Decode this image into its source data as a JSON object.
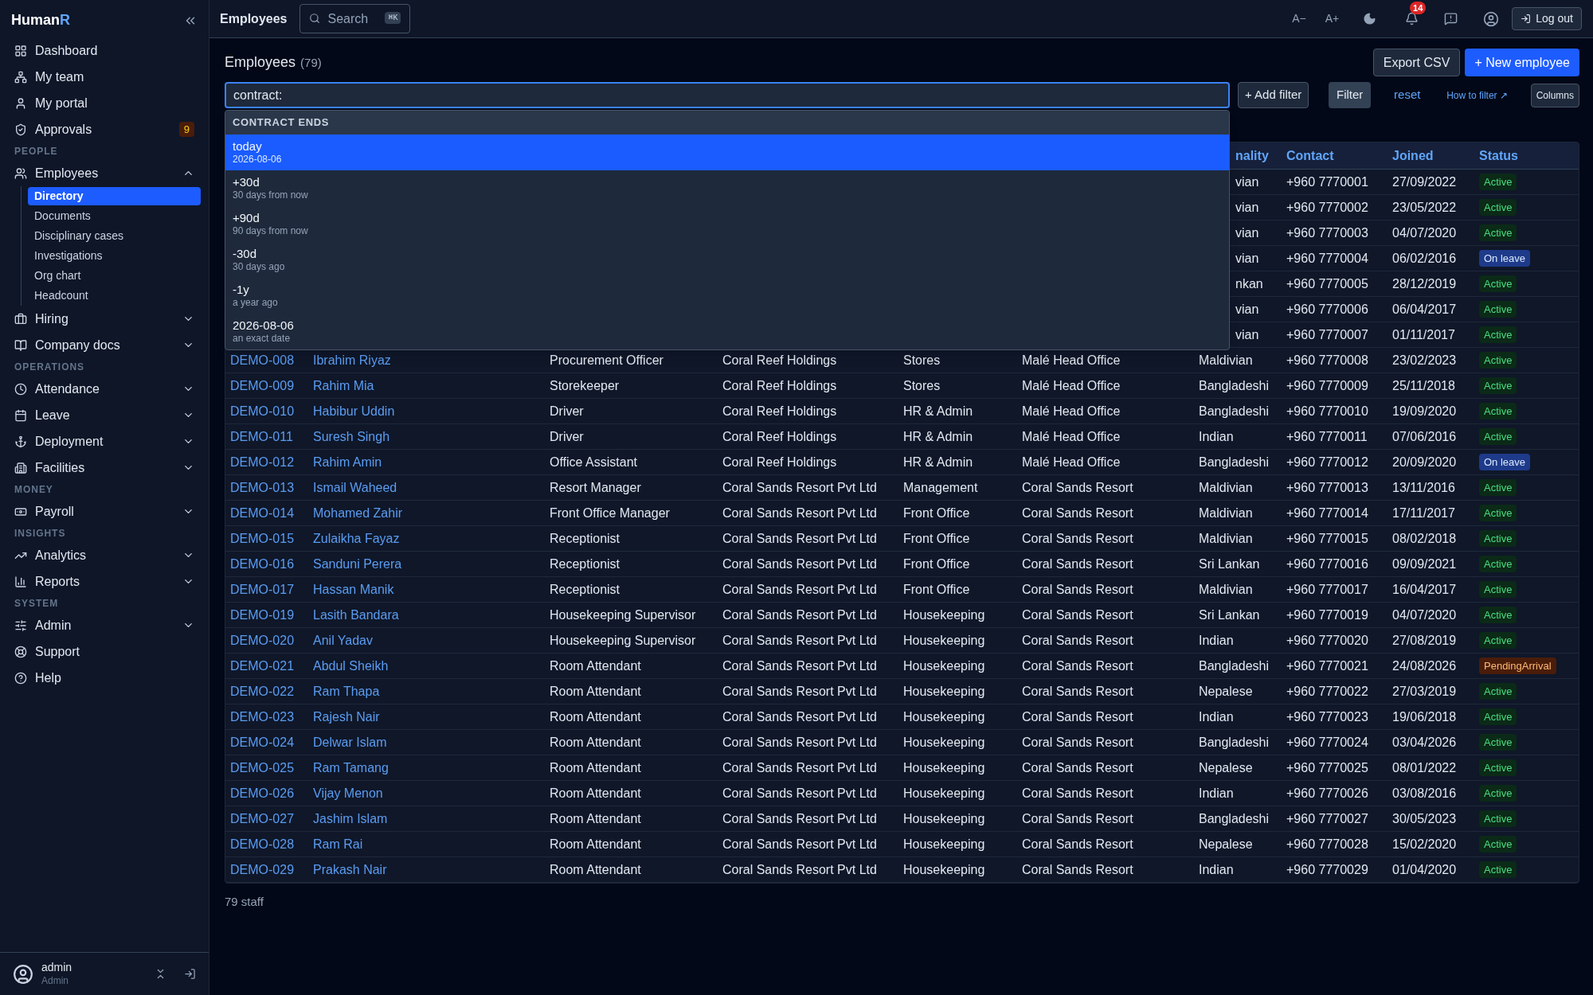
{
  "sidebar": {
    "brand_main": "Human",
    "brand_accent": "R",
    "nav": [
      {
        "kind": "item",
        "label": "Dashboard"
      },
      {
        "kind": "item",
        "label": "My team"
      },
      {
        "kind": "item",
        "label": "My portal"
      },
      {
        "kind": "item",
        "label": "Approvals",
        "badge": "9"
      },
      {
        "kind": "section",
        "label": "PEOPLE"
      },
      {
        "kind": "item",
        "label": "Employees",
        "expanded": true,
        "children": [
          {
            "label": "Directory",
            "selected": true
          },
          {
            "label": "Documents",
            "selected": false
          },
          {
            "label": "Disciplinary cases",
            "selected": false
          },
          {
            "label": "Investigations",
            "selected": false
          },
          {
            "label": "Org chart",
            "selected": false
          },
          {
            "label": "Headcount",
            "selected": false
          }
        ]
      },
      {
        "kind": "item",
        "label": "Hiring",
        "expanded": false
      },
      {
        "kind": "item",
        "label": "Company docs",
        "expanded": false
      },
      {
        "kind": "section",
        "label": "OPERATIONS"
      },
      {
        "kind": "item",
        "label": "Attendance",
        "expanded": false
      },
      {
        "kind": "item",
        "label": "Leave",
        "expanded": false
      },
      {
        "kind": "item",
        "label": "Deployment",
        "expanded": false
      },
      {
        "kind": "item",
        "label": "Facilities",
        "expanded": false
      },
      {
        "kind": "section",
        "label": "MONEY"
      },
      {
        "kind": "item",
        "label": "Payroll",
        "expanded": false
      },
      {
        "kind": "section",
        "label": "INSIGHTS"
      },
      {
        "kind": "item",
        "label": "Analytics",
        "expanded": false
      },
      {
        "kind": "item",
        "label": "Reports",
        "expanded": false
      },
      {
        "kind": "section",
        "label": "SYSTEM"
      },
      {
        "kind": "item",
        "label": "Admin",
        "expanded": false
      },
      {
        "kind": "item",
        "label": "Support"
      },
      {
        "kind": "item",
        "label": "Help"
      }
    ],
    "user": {
      "name": "admin",
      "role": "Admin"
    }
  },
  "topbar": {
    "title": "Employees",
    "search": {
      "placeholder": "Search",
      "shortcut": "⌘K"
    },
    "font_smaller": "A−",
    "font_larger": "A+",
    "notification_count": "14",
    "logout": "Log out"
  },
  "page": {
    "title": "Employees",
    "count": "(79)",
    "export": "Export CSV",
    "new": "+ New employee"
  },
  "filter": {
    "value": "contract:",
    "add_filter": "+ Add filter",
    "apply": "Filter",
    "reset": "reset",
    "help": "How to filter ↗",
    "columns": "Columns",
    "suggestions": {
      "heading": "CONTRACT ENDS",
      "options": [
        {
          "label": "today",
          "hint": "2026-08-06",
          "selected": true
        },
        {
          "label": "+30d",
          "hint": "30 days from now",
          "selected": false
        },
        {
          "label": "+90d",
          "hint": "90 days from now",
          "selected": false
        },
        {
          "label": "-30d",
          "hint": "30 days ago",
          "selected": false
        },
        {
          "label": "-1y",
          "hint": "a year ago",
          "selected": false
        },
        {
          "label": "2026-08-06",
          "hint": "an exact date",
          "selected": false
        }
      ]
    }
  },
  "table": {
    "columns": [
      "nality",
      "Contact",
      "Joined",
      "Status"
    ],
    "rows": [
      {
        "nationality": "vian",
        "contact": "+960 7770001",
        "joined": "27/09/2022",
        "status": {
          "label": "Active",
          "kind": "active"
        }
      },
      {
        "nationality": "vian",
        "contact": "+960 7770002",
        "joined": "23/05/2022",
        "status": {
          "label": "Active",
          "kind": "active"
        }
      },
      {
        "nationality": "vian",
        "contact": "+960 7770003",
        "joined": "04/07/2020",
        "status": {
          "label": "Active",
          "kind": "active"
        }
      },
      {
        "nationality": "vian",
        "contact": "+960 7770004",
        "joined": "06/02/2016",
        "status": {
          "label": "On leave",
          "kind": "leave"
        }
      },
      {
        "nationality": "nkan",
        "contact": "+960 7770005",
        "joined": "28/12/2019",
        "status": {
          "label": "Active",
          "kind": "active"
        }
      },
      {
        "nationality": "vian",
        "contact": "+960 7770006",
        "joined": "06/04/2017",
        "status": {
          "label": "Active",
          "kind": "active"
        }
      },
      {
        "nationality": "vian",
        "contact": "+960 7770007",
        "joined": "01/11/2017",
        "status": {
          "label": "Active",
          "kind": "active"
        }
      },
      {
        "id": "DEMO-008",
        "name": "Ibrahim Riyaz",
        "position": "Procurement Officer",
        "company": "Coral Reef Holdings",
        "department": "Stores",
        "location": "Malé Head Office",
        "nationality": "Maldivian",
        "contact": "+960 7770008",
        "joined": "23/02/2023",
        "status": {
          "label": "Active",
          "kind": "active"
        }
      },
      {
        "id": "DEMO-009",
        "name": "Rahim Mia",
        "position": "Storekeeper",
        "company": "Coral Reef Holdings",
        "department": "Stores",
        "location": "Malé Head Office",
        "nationality": "Bangladeshi",
        "contact": "+960 7770009",
        "joined": "25/11/2018",
        "status": {
          "label": "Active",
          "kind": "active"
        }
      },
      {
        "id": "DEMO-010",
        "name": "Habibur Uddin",
        "position": "Driver",
        "company": "Coral Reef Holdings",
        "department": "HR & Admin",
        "location": "Malé Head Office",
        "nationality": "Bangladeshi",
        "contact": "+960 7770010",
        "joined": "19/09/2020",
        "status": {
          "label": "Active",
          "kind": "active"
        }
      },
      {
        "id": "DEMO-011",
        "name": "Suresh Singh",
        "position": "Driver",
        "company": "Coral Reef Holdings",
        "department": "HR & Admin",
        "location": "Malé Head Office",
        "nationality": "Indian",
        "contact": "+960 7770011",
        "joined": "07/06/2016",
        "status": {
          "label": "Active",
          "kind": "active"
        }
      },
      {
        "id": "DEMO-012",
        "name": "Rahim Amin",
        "position": "Office Assistant",
        "company": "Coral Reef Holdings",
        "department": "HR & Admin",
        "location": "Malé Head Office",
        "nationality": "Bangladeshi",
        "contact": "+960 7770012",
        "joined": "20/09/2020",
        "status": {
          "label": "On leave",
          "kind": "leave"
        }
      },
      {
        "id": "DEMO-013",
        "name": "Ismail Waheed",
        "position": "Resort Manager",
        "company": "Coral Sands Resort Pvt Ltd",
        "department": "Management",
        "location": "Coral Sands Resort",
        "nationality": "Maldivian",
        "contact": "+960 7770013",
        "joined": "13/11/2016",
        "status": {
          "label": "Active",
          "kind": "active"
        }
      },
      {
        "id": "DEMO-014",
        "name": "Mohamed Zahir",
        "position": "Front Office Manager",
        "company": "Coral Sands Resort Pvt Ltd",
        "department": "Front Office",
        "location": "Coral Sands Resort",
        "nationality": "Maldivian",
        "contact": "+960 7770014",
        "joined": "17/11/2017",
        "status": {
          "label": "Active",
          "kind": "active"
        }
      },
      {
        "id": "DEMO-015",
        "name": "Zulaikha Fayaz",
        "position": "Receptionist",
        "company": "Coral Sands Resort Pvt Ltd",
        "department": "Front Office",
        "location": "Coral Sands Resort",
        "nationality": "Maldivian",
        "contact": "+960 7770015",
        "joined": "08/02/2018",
        "status": {
          "label": "Active",
          "kind": "active"
        }
      },
      {
        "id": "DEMO-016",
        "name": "Sanduni Perera",
        "position": "Receptionist",
        "company": "Coral Sands Resort Pvt Ltd",
        "department": "Front Office",
        "location": "Coral Sands Resort",
        "nationality": "Sri Lankan",
        "contact": "+960 7770016",
        "joined": "09/09/2021",
        "status": {
          "label": "Active",
          "kind": "active"
        }
      },
      {
        "id": "DEMO-017",
        "name": "Hassan Manik",
        "position": "Receptionist",
        "company": "Coral Sands Resort Pvt Ltd",
        "department": "Front Office",
        "location": "Coral Sands Resort",
        "nationality": "Maldivian",
        "contact": "+960 7770017",
        "joined": "16/04/2017",
        "status": {
          "label": "Active",
          "kind": "active"
        }
      },
      {
        "id": "DEMO-019",
        "name": "Lasith Bandara",
        "position": "Housekeeping Supervisor",
        "company": "Coral Sands Resort Pvt Ltd",
        "department": "Housekeeping",
        "location": "Coral Sands Resort",
        "nationality": "Sri Lankan",
        "contact": "+960 7770019",
        "joined": "04/07/2020",
        "status": {
          "label": "Active",
          "kind": "active"
        }
      },
      {
        "id": "DEMO-020",
        "name": "Anil Yadav",
        "position": "Housekeeping Supervisor",
        "company": "Coral Sands Resort Pvt Ltd",
        "department": "Housekeeping",
        "location": "Coral Sands Resort",
        "nationality": "Indian",
        "contact": "+960 7770020",
        "joined": "27/08/2019",
        "status": {
          "label": "Active",
          "kind": "active"
        }
      },
      {
        "id": "DEMO-021",
        "name": "Abdul Sheikh",
        "position": "Room Attendant",
        "company": "Coral Sands Resort Pvt Ltd",
        "department": "Housekeeping",
        "location": "Coral Sands Resort",
        "nationality": "Bangladeshi",
        "contact": "+960 7770021",
        "joined": "24/08/2026",
        "status": {
          "label": "PendingArrival",
          "kind": "pending"
        }
      },
      {
        "id": "DEMO-022",
        "name": "Ram Thapa",
        "position": "Room Attendant",
        "company": "Coral Sands Resort Pvt Ltd",
        "department": "Housekeeping",
        "location": "Coral Sands Resort",
        "nationality": "Nepalese",
        "contact": "+960 7770022",
        "joined": "27/03/2019",
        "status": {
          "label": "Active",
          "kind": "active"
        }
      },
      {
        "id": "DEMO-023",
        "name": "Rajesh Nair",
        "position": "Room Attendant",
        "company": "Coral Sands Resort Pvt Ltd",
        "department": "Housekeeping",
        "location": "Coral Sands Resort",
        "nationality": "Indian",
        "contact": "+960 7770023",
        "joined": "19/06/2018",
        "status": {
          "label": "Active",
          "kind": "active"
        }
      },
      {
        "id": "DEMO-024",
        "name": "Delwar Islam",
        "position": "Room Attendant",
        "company": "Coral Sands Resort Pvt Ltd",
        "department": "Housekeeping",
        "location": "Coral Sands Resort",
        "nationality": "Bangladeshi",
        "contact": "+960 7770024",
        "joined": "03/04/2026",
        "status": {
          "label": "Active",
          "kind": "active"
        }
      },
      {
        "id": "DEMO-025",
        "name": "Ram Tamang",
        "position": "Room Attendant",
        "company": "Coral Sands Resort Pvt Ltd",
        "department": "Housekeeping",
        "location": "Coral Sands Resort",
        "nationality": "Nepalese",
        "contact": "+960 7770025",
        "joined": "08/01/2022",
        "status": {
          "label": "Active",
          "kind": "active"
        }
      },
      {
        "id": "DEMO-026",
        "name": "Vijay Menon",
        "position": "Room Attendant",
        "company": "Coral Sands Resort Pvt Ltd",
        "department": "Housekeeping",
        "location": "Coral Sands Resort",
        "nationality": "Indian",
        "contact": "+960 7770026",
        "joined": "03/08/2016",
        "status": {
          "label": "Active",
          "kind": "active"
        }
      },
      {
        "id": "DEMO-027",
        "name": "Jashim Islam",
        "position": "Room Attendant",
        "company": "Coral Sands Resort Pvt Ltd",
        "department": "Housekeeping",
        "location": "Coral Sands Resort",
        "nationality": "Bangladeshi",
        "contact": "+960 7770027",
        "joined": "30/05/2023",
        "status": {
          "label": "Active",
          "kind": "active"
        }
      },
      {
        "id": "DEMO-028",
        "name": "Ram Rai",
        "position": "Room Attendant",
        "company": "Coral Sands Resort Pvt Ltd",
        "department": "Housekeeping",
        "location": "Coral Sands Resort",
        "nationality": "Nepalese",
        "contact": "+960 7770028",
        "joined": "15/02/2020",
        "status": {
          "label": "Active",
          "kind": "active"
        }
      },
      {
        "id": "DEMO-029",
        "name": "Prakash Nair",
        "position": "Room Attendant",
        "company": "Coral Sands Resort Pvt Ltd",
        "department": "Housekeeping",
        "location": "Coral Sands Resort",
        "nationality": "Indian",
        "contact": "+960 7770029",
        "joined": "01/04/2020",
        "status": {
          "label": "Active",
          "kind": "active"
        }
      }
    ],
    "footer": "79 staff"
  }
}
